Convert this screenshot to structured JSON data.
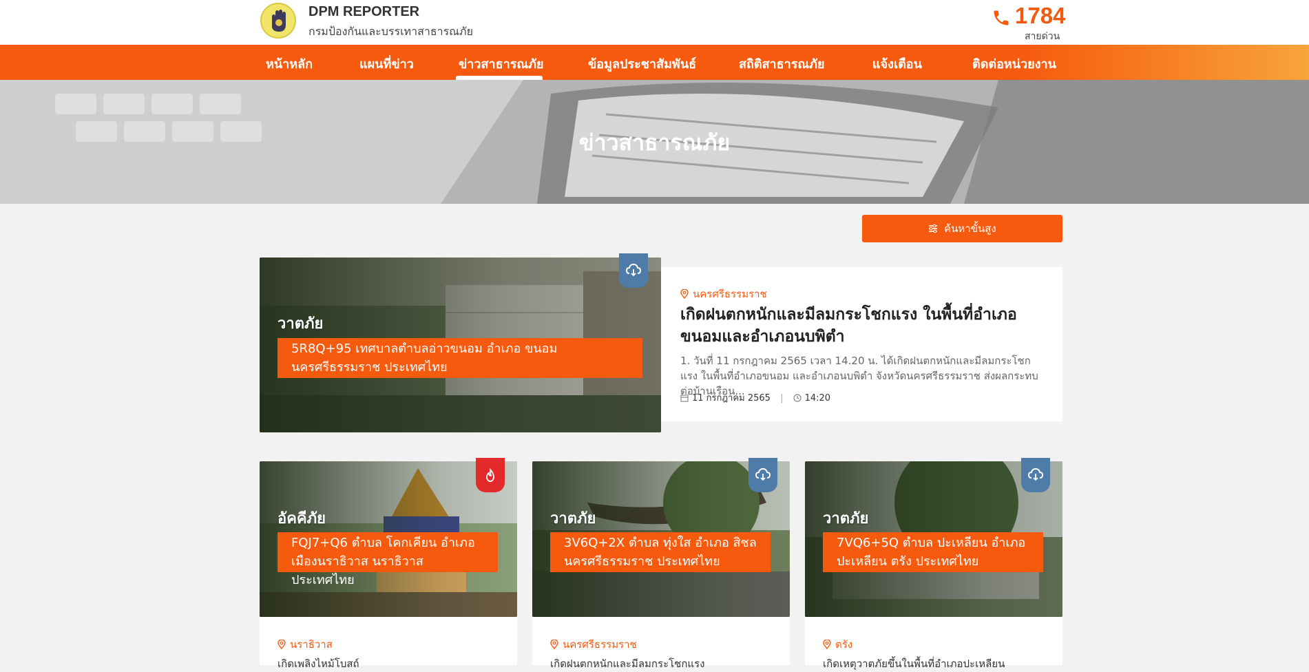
{
  "brand": {
    "title": "DPM REPORTER",
    "subtitle": "กรมป้องกันและบรรเทาสาธารณภัย"
  },
  "hotline": {
    "number": "1784",
    "label": "สายด่วน"
  },
  "nav": [
    {
      "label": "หน้าหลัก"
    },
    {
      "label": "แผนที่ข่าว"
    },
    {
      "label": "ข่าวสาธารณภัย"
    },
    {
      "label": "ข้อมูลประชาสัมพันธ์"
    },
    {
      "label": "สถิติสาธารณภัย"
    },
    {
      "label": "แจ้งเตือน"
    },
    {
      "label": "ติดต่อหน่วยงาน"
    }
  ],
  "hero": {
    "title": "ข่าวสาธารณภัย"
  },
  "search": {
    "label": "ค้นหาขั้นสูง",
    "icon": "sliders-icon"
  },
  "featured": {
    "category": "วาตภัย",
    "address": "5R8Q+95 เทศบาลตำบลอ่าวขนอม อำเภอ ขนอม นครศรีธรรมราช ประเทศไทย",
    "badge_icon": "cloud-icon",
    "badge_color": "#4e7ba8",
    "province": "นครศรีธรรมราช",
    "title": "เกิดฝนตกหนักและมีลมกระโชกแรง ในพื้นที่อำเภอขนอมและอำเภอนบพิตำ",
    "description": "1. วันที่ 11 กรกฎาคม 2565 เวลา 14.20 น. ได้เกิดฝนตกหนักและมีลมกระโชกแรง ในพื้นที่อำเภอขนอม และอำเภอนบพิตำ จังหวัดนครศรีธรรมราช ส่งผลกระทบต่อบ้านเรือน...",
    "date": "11 กรกฎาคม 2565",
    "time": "14:20"
  },
  "cards": [
    {
      "category": "อัคคีภัย",
      "address": "FQJ7+Q6 ตำบล โคกเคียน อำเภอ เมืองนราธิวาส นราธิวาส ประเทศไทย",
      "badge_icon": "fire-icon",
      "badge_color": "#e32a2a",
      "province": "นราธิวาส",
      "title": "เกิดเพลิงไหม้โบสถ์"
    },
    {
      "category": "วาตภัย",
      "address": "3V6Q+2X ตำบล ทุ่งใส อำเภอ สิชล นครศรีธรรมราช ประเทศไทย",
      "badge_icon": "cloud-icon",
      "badge_color": "#4e7ba8",
      "province": "นครศรีธรรมราช",
      "title": "เกิดฝนตกหนักและมีลมกระโชกแรง"
    },
    {
      "category": "วาตภัย",
      "address": "7VQ6+5Q ตำบล ปะเหลียน อำเภอ ปะเหลียน ตรัง ประเทศไทย",
      "badge_icon": "cloud-icon",
      "badge_color": "#4e7ba8",
      "province": "ตรัง",
      "title": "เกิดเหตุวาตภัยขึ้นในพื้นที่อำเภอปะเหลียน"
    }
  ]
}
